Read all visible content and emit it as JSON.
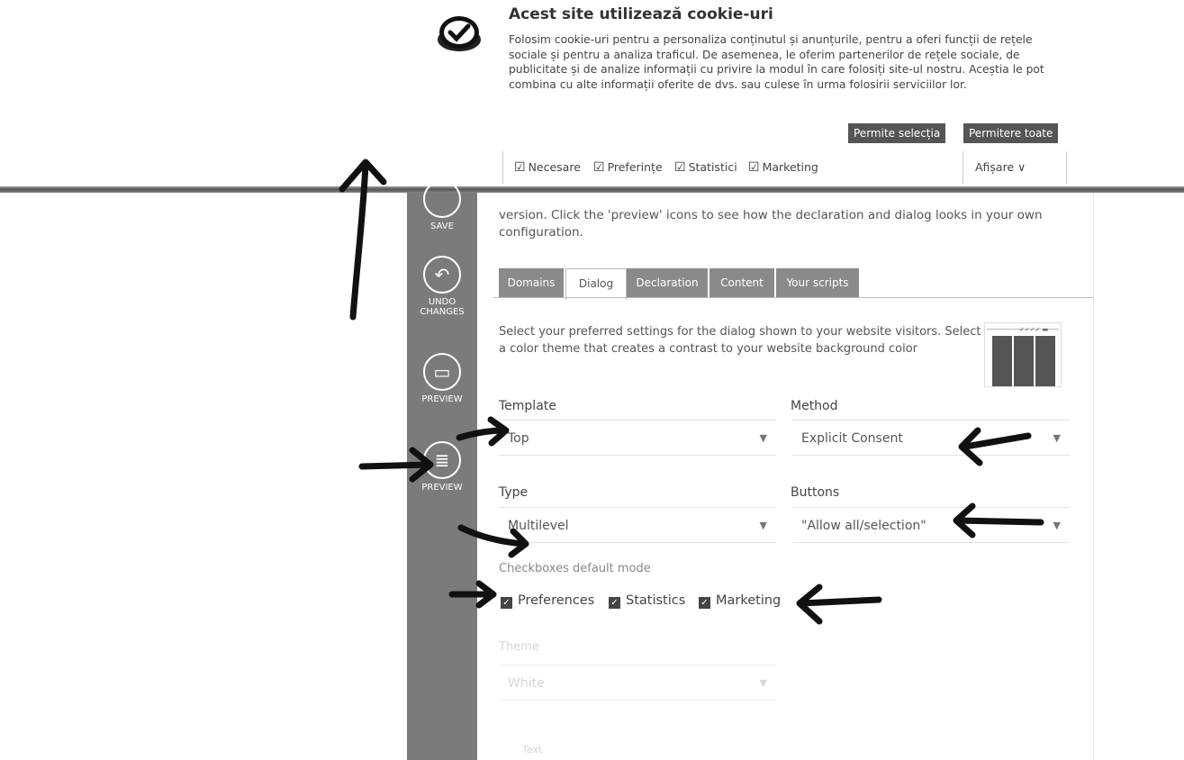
{
  "banner": {
    "title": "Acest site utilizează cookie-uri",
    "text": "Folosim cookie-uri pentru a personaliza conținutul și anunțurile, pentru a oferi funcții de rețele sociale și pentru a analiza traficul. De asemenea, le oferim partenerilor de rețele sociale, de publicitate și de analize informații cu privire la modul în care folosiți site-ul nostru. Aceștia le pot combina cu alte informații oferite de dvs. sau culese în urma folosirii serviciilor lor.",
    "allow_selection_label": "Permite selecția",
    "allow_all_label": "Permitere toate",
    "consent_options": [
      "Necesare",
      "Preferințe",
      "Statistici",
      "Marketing"
    ],
    "details_label": "Afișare",
    "details_icon": "chevron-down-icon"
  },
  "rail": {
    "save_label": "SAVE",
    "undo_label_1": "UNDO",
    "undo_label_2": "CHANGES",
    "preview1_label": "PREVIEW",
    "preview2_label": "PREVIEW"
  },
  "intro": {
    "line1": "version. Click the 'preview' icons to see how the declaration and dialog looks in your own",
    "line2": "configuration."
  },
  "tabs": [
    "Domains",
    "Dialog",
    "Declaration",
    "Content",
    "Your scripts"
  ],
  "active_tab": "Dialog",
  "dialog": {
    "description_line1": "Select your preferred settings for the dialog shown to your website visitors. Select",
    "description_line2": "a color theme that creates a contrast to your website background color",
    "template": {
      "label": "Template",
      "value": "Top"
    },
    "method": {
      "label": "Method",
      "value": "Explicit Consent"
    },
    "type": {
      "label": "Type",
      "value": "Multilevel"
    },
    "buttons": {
      "label": "Buttons",
      "value": "\"Allow all/selection\""
    },
    "checkbox_mode_label": "Checkboxes default mode",
    "checkboxes": [
      {
        "label": "Preferences",
        "checked": true
      },
      {
        "label": "Statistics",
        "checked": true
      },
      {
        "label": "Marketing",
        "checked": true
      }
    ],
    "theme": {
      "label": "Theme",
      "value": "White"
    },
    "bottom_faded": "Text"
  },
  "colors": {
    "rail": "#7b7b7b",
    "tab_inactive": "#8a8a8a",
    "button_dark": "#555555",
    "annotation": "#111111"
  }
}
